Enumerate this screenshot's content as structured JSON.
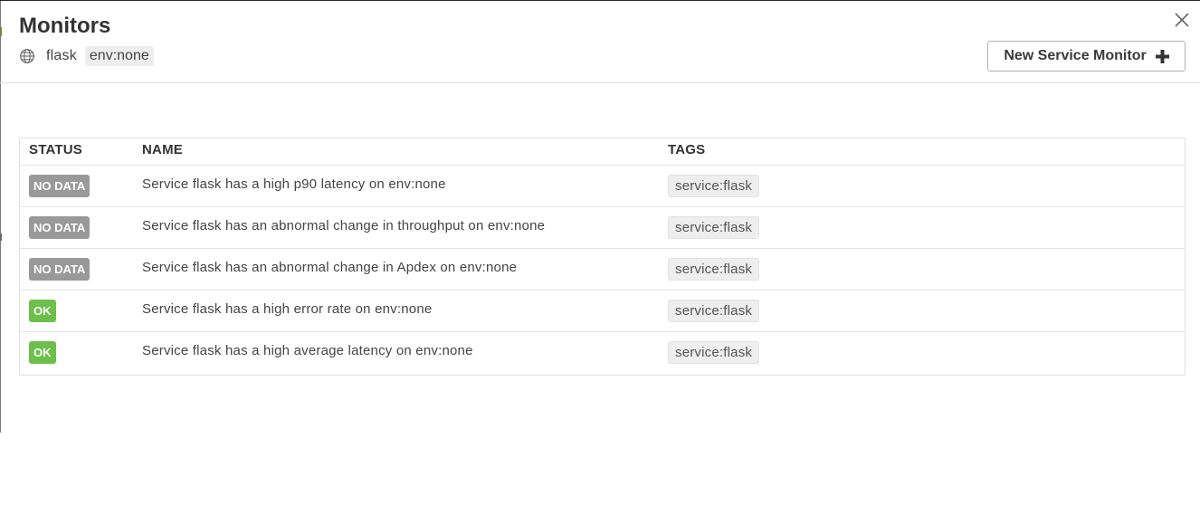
{
  "header": {
    "title": "Monitors",
    "service": "flask",
    "env_tag": "env:none",
    "new_monitor_label": "New Service Monitor",
    "icons": {
      "globe": "globe-icon",
      "close": "close-icon",
      "plus": "plus-icon"
    }
  },
  "table": {
    "columns": {
      "status": "STATUS",
      "name": "NAME",
      "tags": "TAGS"
    },
    "rows": [
      {
        "status": "NO DATA",
        "status_type": "nodata",
        "name": "Service flask has a high p90 latency on env:none",
        "tag": "service:flask"
      },
      {
        "status": "NO DATA",
        "status_type": "nodata",
        "name": "Service flask has an abnormal change in throughput on env:none",
        "tag": "service:flask"
      },
      {
        "status": "NO DATA",
        "status_type": "nodata",
        "name": "Service flask has an abnormal change in Apdex on env:none",
        "tag": "service:flask"
      },
      {
        "status": "OK",
        "status_type": "ok",
        "name": "Service flask has a high error rate on env:none",
        "tag": "service:flask"
      },
      {
        "status": "OK",
        "status_type": "ok",
        "name": "Service flask has a high average latency on env:none",
        "tag": "service:flask"
      }
    ]
  },
  "colors": {
    "nodata": "#999999",
    "ok": "#6cbf4a",
    "tag_bg": "#eeeeee",
    "text": "#333333"
  }
}
